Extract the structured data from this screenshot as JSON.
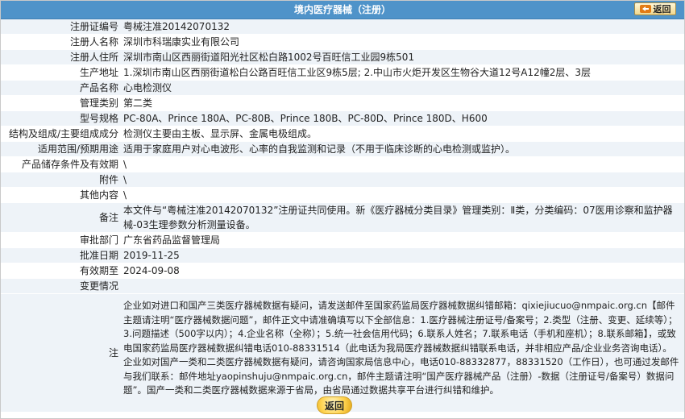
{
  "header": {
    "title": "境内医疗器械（注册）",
    "back_label": "返回"
  },
  "fields": [
    {
      "label": "注册证编号",
      "value": "粤械注准20142070132"
    },
    {
      "label": "注册人名称",
      "value": "深圳市科瑞康实业有限公司"
    },
    {
      "label": "注册人住所",
      "value": "深圳市南山区西丽街道阳光社区松白路1002号百旺信工业园9栋501"
    },
    {
      "label": "生产地址",
      "value": "1.深圳市南山区西丽街道松白公路百旺信工业区9栋5层; 2.中山市火炬开发区生物谷大道12号A12幢2层、3层"
    },
    {
      "label": "产品名称",
      "value": "心电检测仪"
    },
    {
      "label": "管理类别",
      "value": "第二类"
    },
    {
      "label": "型号规格",
      "value": "PC-80A、Prince 180A、PC-80B、Prince 180B、PC-80D、Prince 180D、H600"
    },
    {
      "label": "结构及组成/主要组成成分",
      "value": "检测仪主要由主板、显示屏、金属电极组成。"
    },
    {
      "label": "适用范围/预期用途",
      "value": "适用于家庭用户对心电波形、心率的自我监测和记录（不用于临床诊断的心电检测或监护）。"
    },
    {
      "label": "产品储存条件及有效期",
      "value": "\\"
    },
    {
      "label": "附件",
      "value": "\\"
    },
    {
      "label": "其他内容",
      "value": "\\"
    },
    {
      "label": "备注",
      "value": "本文件与“粤械注准20142070132”注册证共同使用。新《医疗器械分类目录》管理类别：Ⅱ类，分类编码：07医用诊察和监护器械-03生理参数分析测量设备。"
    },
    {
      "label": "审批部门",
      "value": "广东省药品监督管理局"
    },
    {
      "label": "批准日期",
      "value": "2019-11-25"
    },
    {
      "label": "有效期至",
      "value": "2024-09-08"
    },
    {
      "label": "变更情况",
      "value": ""
    }
  ],
  "note": {
    "label": "注",
    "text": "企业如对进口和国产三类医疗器械数据有疑问，请发送邮件至国家药监局医疗器械数据纠错邮箱：qixiejiucuo@nmpaic.org.cn【邮件主题请注明“医疗器械数据问题”，邮件正文中请准确填写以下全部信息：1.医疗器械注册证号/备案号；2.类型（注册、变更、延续等）；3.问题描述（500字以内）；4.企业名称（全称）；5.统一社会信用代码；6.联系人姓名；7.联系电话（手机和座机）；8.联系邮箱】，或致电国家药监局医疗器械数据纠错电话010-88331514（此电话为我局医疗器械数据纠错联系电话，并非相应产品/企业业务咨询电话）。企业如对国产一类和二类医疗器械数据有疑问，请咨询国家局信息中心，电话010-88332877，88331520（工作日），也可通过发邮件与我们联系：邮件地址yaopinshuju@nmpaic.org.cn，邮件主题请注明“国产医疗器械产品（注册）-数据（注册证号/备案号）数据问题”。国产一类和二类医疗器械数据来源于省局，由省局通过数据共享平台进行纠错和维护。"
  },
  "footer": {
    "back_label": "返回"
  }
}
